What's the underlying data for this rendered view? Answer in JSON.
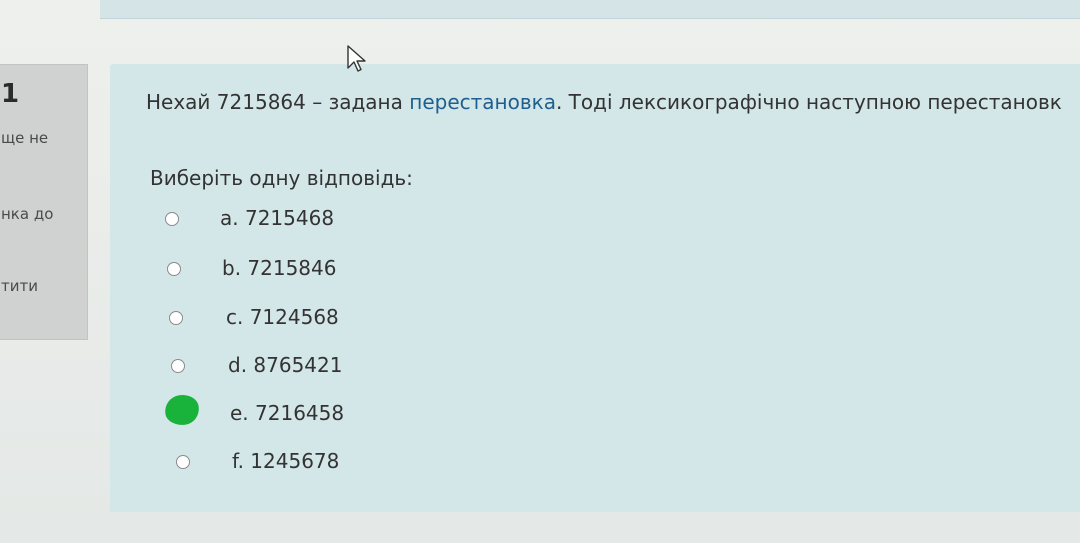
{
  "info": {
    "question_number": "1",
    "status_line1": "ще не",
    "status_line2": "нка до",
    "status_line3": "тити"
  },
  "question": {
    "text_before": "Нехай 7215864 – задана ",
    "text_link": "перестановка",
    "text_after": ". Тоді лексикографічно наступною перестановк"
  },
  "prompt": "Виберіть одну відповідь:",
  "options": [
    {
      "label": "a. 7215468"
    },
    {
      "label": "b. 7215846"
    },
    {
      "label": "c. 7124568"
    },
    {
      "label": "d. 8765421"
    },
    {
      "label": "e. 7216458"
    },
    {
      "label": "f. 1245678"
    }
  ],
  "colors": {
    "panel": "#d3e6e8",
    "link": "#1f5f8f",
    "selected_mark": "#19b23a"
  }
}
